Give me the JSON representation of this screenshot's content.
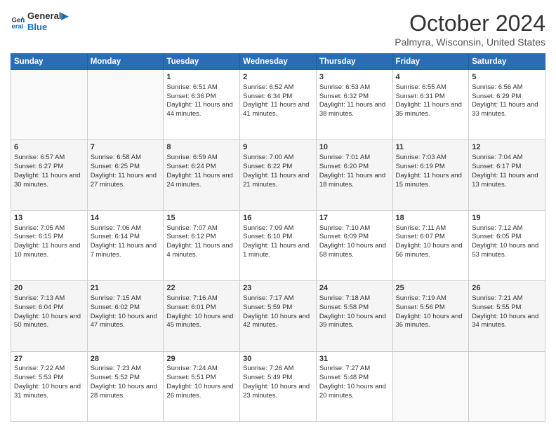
{
  "header": {
    "logo_line1": "General",
    "logo_line2": "Blue",
    "month": "October 2024",
    "location": "Palmyra, Wisconsin, United States"
  },
  "weekdays": [
    "Sunday",
    "Monday",
    "Tuesday",
    "Wednesday",
    "Thursday",
    "Friday",
    "Saturday"
  ],
  "weeks": [
    [
      {
        "day": "",
        "sunrise": "",
        "sunset": "",
        "daylight": ""
      },
      {
        "day": "",
        "sunrise": "",
        "sunset": "",
        "daylight": ""
      },
      {
        "day": "1",
        "sunrise": "Sunrise: 6:51 AM",
        "sunset": "Sunset: 6:36 PM",
        "daylight": "Daylight: 11 hours and 44 minutes."
      },
      {
        "day": "2",
        "sunrise": "Sunrise: 6:52 AM",
        "sunset": "Sunset: 6:34 PM",
        "daylight": "Daylight: 11 hours and 41 minutes."
      },
      {
        "day": "3",
        "sunrise": "Sunrise: 6:53 AM",
        "sunset": "Sunset: 6:32 PM",
        "daylight": "Daylight: 11 hours and 38 minutes."
      },
      {
        "day": "4",
        "sunrise": "Sunrise: 6:55 AM",
        "sunset": "Sunset: 6:31 PM",
        "daylight": "Daylight: 11 hours and 35 minutes."
      },
      {
        "day": "5",
        "sunrise": "Sunrise: 6:56 AM",
        "sunset": "Sunset: 6:29 PM",
        "daylight": "Daylight: 11 hours and 33 minutes."
      }
    ],
    [
      {
        "day": "6",
        "sunrise": "Sunrise: 6:57 AM",
        "sunset": "Sunset: 6:27 PM",
        "daylight": "Daylight: 11 hours and 30 minutes."
      },
      {
        "day": "7",
        "sunrise": "Sunrise: 6:58 AM",
        "sunset": "Sunset: 6:25 PM",
        "daylight": "Daylight: 11 hours and 27 minutes."
      },
      {
        "day": "8",
        "sunrise": "Sunrise: 6:59 AM",
        "sunset": "Sunset: 6:24 PM",
        "daylight": "Daylight: 11 hours and 24 minutes."
      },
      {
        "day": "9",
        "sunrise": "Sunrise: 7:00 AM",
        "sunset": "Sunset: 6:22 PM",
        "daylight": "Daylight: 11 hours and 21 minutes."
      },
      {
        "day": "10",
        "sunrise": "Sunrise: 7:01 AM",
        "sunset": "Sunset: 6:20 PM",
        "daylight": "Daylight: 11 hours and 18 minutes."
      },
      {
        "day": "11",
        "sunrise": "Sunrise: 7:03 AM",
        "sunset": "Sunset: 6:19 PM",
        "daylight": "Daylight: 11 hours and 15 minutes."
      },
      {
        "day": "12",
        "sunrise": "Sunrise: 7:04 AM",
        "sunset": "Sunset: 6:17 PM",
        "daylight": "Daylight: 11 hours and 13 minutes."
      }
    ],
    [
      {
        "day": "13",
        "sunrise": "Sunrise: 7:05 AM",
        "sunset": "Sunset: 6:15 PM",
        "daylight": "Daylight: 11 hours and 10 minutes."
      },
      {
        "day": "14",
        "sunrise": "Sunrise: 7:06 AM",
        "sunset": "Sunset: 6:14 PM",
        "daylight": "Daylight: 11 hours and 7 minutes."
      },
      {
        "day": "15",
        "sunrise": "Sunrise: 7:07 AM",
        "sunset": "Sunset: 6:12 PM",
        "daylight": "Daylight: 11 hours and 4 minutes."
      },
      {
        "day": "16",
        "sunrise": "Sunrise: 7:09 AM",
        "sunset": "Sunset: 6:10 PM",
        "daylight": "Daylight: 11 hours and 1 minute."
      },
      {
        "day": "17",
        "sunrise": "Sunrise: 7:10 AM",
        "sunset": "Sunset: 6:09 PM",
        "daylight": "Daylight: 10 hours and 58 minutes."
      },
      {
        "day": "18",
        "sunrise": "Sunrise: 7:11 AM",
        "sunset": "Sunset: 6:07 PM",
        "daylight": "Daylight: 10 hours and 56 minutes."
      },
      {
        "day": "19",
        "sunrise": "Sunrise: 7:12 AM",
        "sunset": "Sunset: 6:05 PM",
        "daylight": "Daylight: 10 hours and 53 minutes."
      }
    ],
    [
      {
        "day": "20",
        "sunrise": "Sunrise: 7:13 AM",
        "sunset": "Sunset: 6:04 PM",
        "daylight": "Daylight: 10 hours and 50 minutes."
      },
      {
        "day": "21",
        "sunrise": "Sunrise: 7:15 AM",
        "sunset": "Sunset: 6:02 PM",
        "daylight": "Daylight: 10 hours and 47 minutes."
      },
      {
        "day": "22",
        "sunrise": "Sunrise: 7:16 AM",
        "sunset": "Sunset: 6:01 PM",
        "daylight": "Daylight: 10 hours and 45 minutes."
      },
      {
        "day": "23",
        "sunrise": "Sunrise: 7:17 AM",
        "sunset": "Sunset: 5:59 PM",
        "daylight": "Daylight: 10 hours and 42 minutes."
      },
      {
        "day": "24",
        "sunrise": "Sunrise: 7:18 AM",
        "sunset": "Sunset: 5:58 PM",
        "daylight": "Daylight: 10 hours and 39 minutes."
      },
      {
        "day": "25",
        "sunrise": "Sunrise: 7:19 AM",
        "sunset": "Sunset: 5:56 PM",
        "daylight": "Daylight: 10 hours and 36 minutes."
      },
      {
        "day": "26",
        "sunrise": "Sunrise: 7:21 AM",
        "sunset": "Sunset: 5:55 PM",
        "daylight": "Daylight: 10 hours and 34 minutes."
      }
    ],
    [
      {
        "day": "27",
        "sunrise": "Sunrise: 7:22 AM",
        "sunset": "Sunset: 5:53 PM",
        "daylight": "Daylight: 10 hours and 31 minutes."
      },
      {
        "day": "28",
        "sunrise": "Sunrise: 7:23 AM",
        "sunset": "Sunset: 5:52 PM",
        "daylight": "Daylight: 10 hours and 28 minutes."
      },
      {
        "day": "29",
        "sunrise": "Sunrise: 7:24 AM",
        "sunset": "Sunset: 5:51 PM",
        "daylight": "Daylight: 10 hours and 26 minutes."
      },
      {
        "day": "30",
        "sunrise": "Sunrise: 7:26 AM",
        "sunset": "Sunset: 5:49 PM",
        "daylight": "Daylight: 10 hours and 23 minutes."
      },
      {
        "day": "31",
        "sunrise": "Sunrise: 7:27 AM",
        "sunset": "Sunset: 5:48 PM",
        "daylight": "Daylight: 10 hours and 20 minutes."
      },
      {
        "day": "",
        "sunrise": "",
        "sunset": "",
        "daylight": ""
      },
      {
        "day": "",
        "sunrise": "",
        "sunset": "",
        "daylight": ""
      }
    ]
  ]
}
